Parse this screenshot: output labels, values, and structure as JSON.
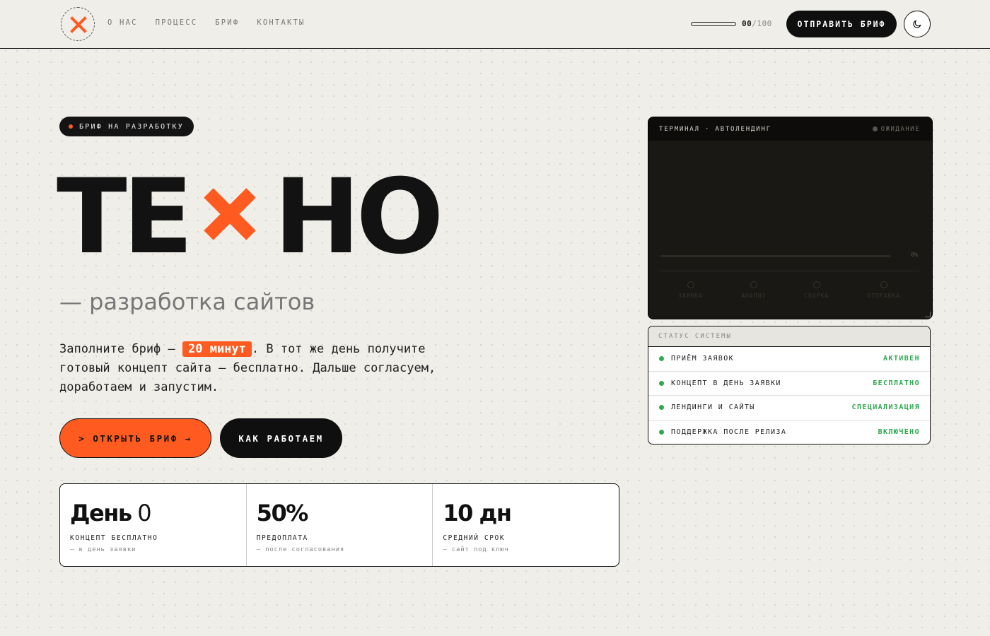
{
  "nav": {
    "items": [
      "О НАС",
      "ПРОЦЕСС",
      "БРИФ",
      "КОНТАКТЫ"
    ]
  },
  "progress": {
    "current": "00",
    "total": "/100",
    "value": 0
  },
  "header": {
    "send_label": "ОТПРАВИТЬ БРИФ",
    "theme_icon": "moon-icon"
  },
  "hero": {
    "badge": "БРИФ НА РАЗРАБОТКУ",
    "title_left": "ТЕ",
    "title_right": "НО",
    "title_mark_icon": "x-mark-icon",
    "subtitle": "— разработка сайтов",
    "lead_before": "Заполните бриф — ",
    "lead_highlight": "20 минут",
    "lead_after": ". В тот же день получите готовый концепт сайта — бесплатно. Дальше согласуем, доработаем и запустим.",
    "open_label": "> ОТКРЫТЬ БРИФ →",
    "how_label": "КАК РАБОТАЕМ"
  },
  "stats": [
    {
      "big_bold": "День",
      "big_light": " 0",
      "label": "КОНЦЕПТ БЕСПЛАТНО",
      "note": "— в день заявки"
    },
    {
      "big_bold": "50%",
      "big_light": "",
      "label": "ПРЕДОПЛАТА",
      "note": "— после согласования"
    },
    {
      "big_bold": "10 дн",
      "big_light": "",
      "label": "СРЕДНИЙ СРОК",
      "note": "— сайт под ключ"
    }
  ],
  "terminal": {
    "title": "ТЕРМИНАЛ · АВТОЛЕНДИНГ",
    "status": "ОЖИДАНИЕ",
    "percent": "0%",
    "steps": [
      "ЗАЯВКА",
      "АНАЛИЗ",
      "СБОРКА",
      "ОТПРАВКА"
    ]
  },
  "status_panel": {
    "title": "СТАТУС СИСТЕМЫ",
    "rows": [
      {
        "name": "ПРИЁМ ЗАЯВОК",
        "value": "АКТИВЕН"
      },
      {
        "name": "КОНЦЕПТ В ДЕНЬ ЗАЯВКИ",
        "value": "БЕСПЛАТНО"
      },
      {
        "name": "ЛЕНДИНГИ И САЙТЫ",
        "value": "СПЕЦИАЛИЗАЦИЯ"
      },
      {
        "name": "ПОДДЕРЖКА ПОСЛЕ РЕЛИЗА",
        "value": "ВКЛЮЧЕНО"
      }
    ]
  },
  "colors": {
    "accent": "#ff5a1f",
    "dark": "#0f0f0f",
    "ok": "#2fa84f",
    "background": "#efeee9"
  }
}
